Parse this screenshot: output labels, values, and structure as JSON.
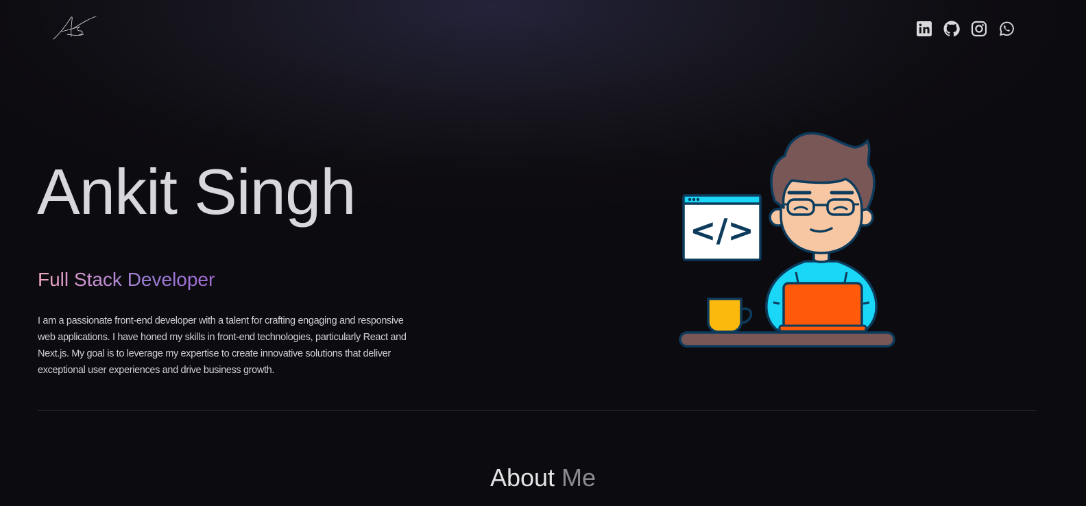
{
  "header": {
    "logo_icon": "signature-logo",
    "social_links": [
      {
        "icon": "linkedin-icon",
        "label": "LinkedIn"
      },
      {
        "icon": "github-icon",
        "label": "GitHub"
      },
      {
        "icon": "instagram-icon",
        "label": "Instagram"
      },
      {
        "icon": "whatsapp-icon",
        "label": "WhatsApp"
      }
    ]
  },
  "hero": {
    "name": "Ankit Singh",
    "role": "Full Stack Developer",
    "description": "I am a passionate front-end developer with a talent for crafting engaging and responsive web applications. I have honed my skills in front-end technologies, particularly React and Next.js. My goal is to leverage my expertise to create innovative solutions that deliver exceptional user experiences and drive business growth.",
    "illustration": "developer-at-laptop-illustration",
    "code_window_text": "</>"
  },
  "about": {
    "title_part1": "About",
    "title_part2": "Me"
  },
  "colors": {
    "background": "#0d0c11",
    "role_gradient_start": "#f2a4c2",
    "role_gradient_end": "#a56bd8",
    "illustration_shirt": "#1ad7f7",
    "illustration_laptop": "#ff5a09",
    "illustration_mug": "#fbb80d",
    "illustration_outline": "#0c3b5c"
  }
}
